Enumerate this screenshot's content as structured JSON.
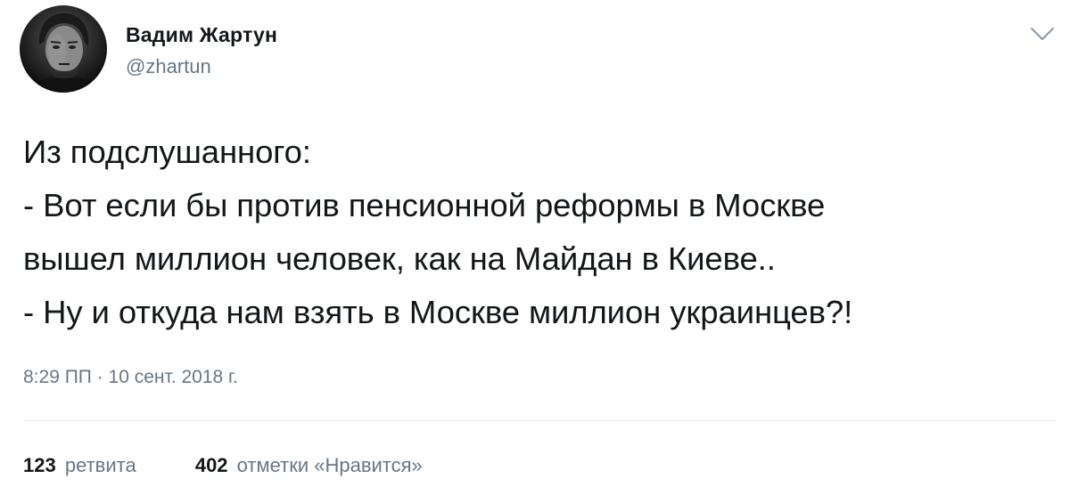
{
  "author": {
    "display_name": "Вадим Жартун",
    "handle": "@zhartun"
  },
  "icons": {
    "menu": "chevron-down-icon",
    "avatar": "avatar-photo"
  },
  "tweet": {
    "lines": [
      "Из подслушанного:",
      "- Вот если бы против пенсионной реформы в Москве",
      "вышел миллион человек, как на Майдан в Киеве..",
      "- Ну и откуда нам взять в Москве миллион украинцев?!"
    ],
    "timestamp": "8:29 ПП · 10 сент. 2018 г."
  },
  "stats": {
    "retweets_count": "123",
    "retweets_label": "ретвита",
    "likes_count": "402",
    "likes_label": "отметки «Нравится»"
  },
  "colors": {
    "text": "#14171a",
    "secondary": "#657786",
    "divider": "#e1e8ed",
    "chevron": "#8899a6"
  }
}
